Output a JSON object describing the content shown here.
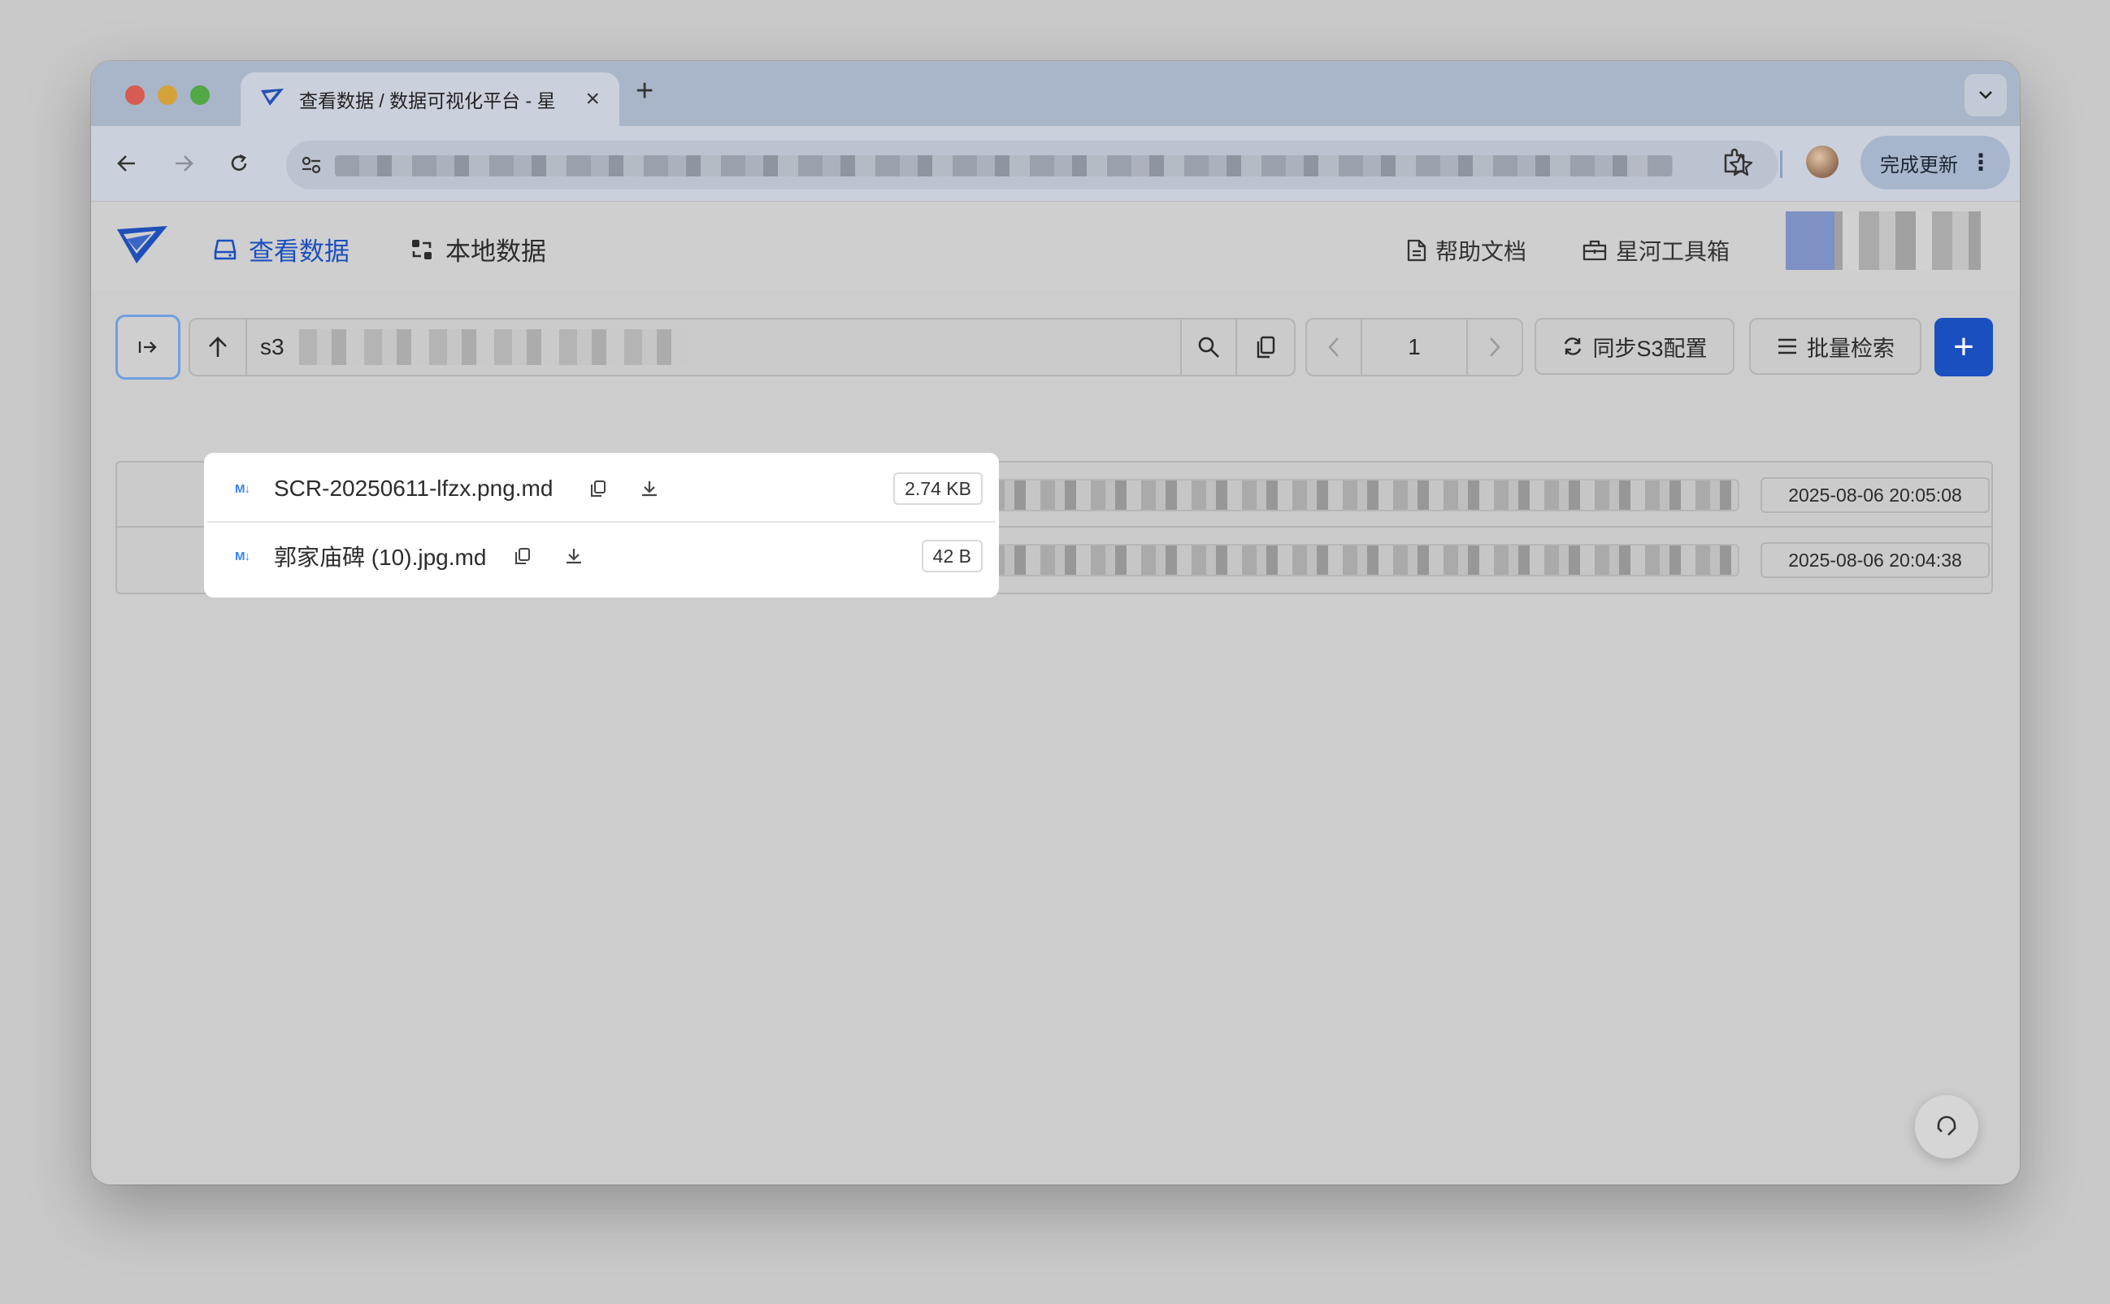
{
  "browser": {
    "tab_title": "查看数据 / 数据可视化平台 - 星",
    "update_label": "完成更新"
  },
  "nav": {
    "view_data": "查看数据",
    "local_data": "本地数据",
    "help_docs": "帮助文档",
    "toolbox": "星河工具箱"
  },
  "toolbar": {
    "path_root": "s3",
    "page_number": "1",
    "sync_label": "同步S3配置",
    "batch_label": "批量检索",
    "add_label": "+"
  },
  "files": [
    {
      "icon": "M↓",
      "name": "SCR-20250611-lfzx.png.md",
      "size": "2.74 KB",
      "date": "2025-08-06 20:05:08"
    },
    {
      "icon": "M↓",
      "name": "郭家庙碑 (10).jpg.md",
      "size": "42 B",
      "date": "2025-08-06 20:04:38"
    }
  ],
  "colors": {
    "accent": "#1a4fbf",
    "md_icon": "#3b82f6"
  }
}
